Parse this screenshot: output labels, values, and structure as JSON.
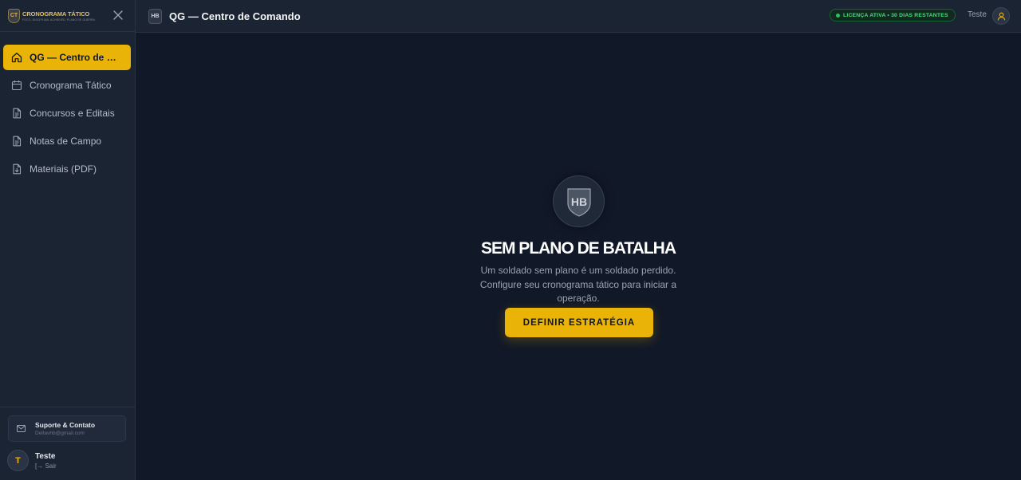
{
  "sidebar": {
    "logo_title": "CRONOGRAMA TÁTICO",
    "logo_sub": "FOCO, DISCIPLINA, ACHIEVED. PLANO DE GUERRA",
    "logo_mark": "CT",
    "items": [
      {
        "label": "QG — Centro de Comando",
        "icon": "home-icon",
        "active": true
      },
      {
        "label": "Cronograma Tático",
        "icon": "calendar-icon",
        "active": false
      },
      {
        "label": "Concursos e Editais",
        "icon": "document-icon",
        "active": false
      },
      {
        "label": "Notas de Campo",
        "icon": "notes-icon",
        "active": false
      },
      {
        "label": "Materiais (PDF)",
        "icon": "file-download-icon",
        "active": false
      }
    ],
    "support": {
      "title": "Suporte & Contato",
      "email": "Deltavhb@gmail.com"
    },
    "user": {
      "initial": "T",
      "name": "Teste",
      "logout_label": "Sair"
    }
  },
  "topbar": {
    "logo_mark": "HB",
    "title": "QG — Centro de Comando",
    "license": "LICENÇA ATIVA • 30 DIAS RESTANTES",
    "user_name": "Teste"
  },
  "empty_state": {
    "emblem": "HB",
    "title": "SEM PLANO DE BATALHA",
    "description": "Um soldado sem plano é um soldado perdido. Configure seu cronograma tático para iniciar a operação.",
    "cta_label": "DEFINIR ESTRATÉGIA"
  },
  "colors": {
    "accent": "#eab308",
    "background": "#111827",
    "sidebar": "#1b2433",
    "license_green": "#4ade80"
  }
}
